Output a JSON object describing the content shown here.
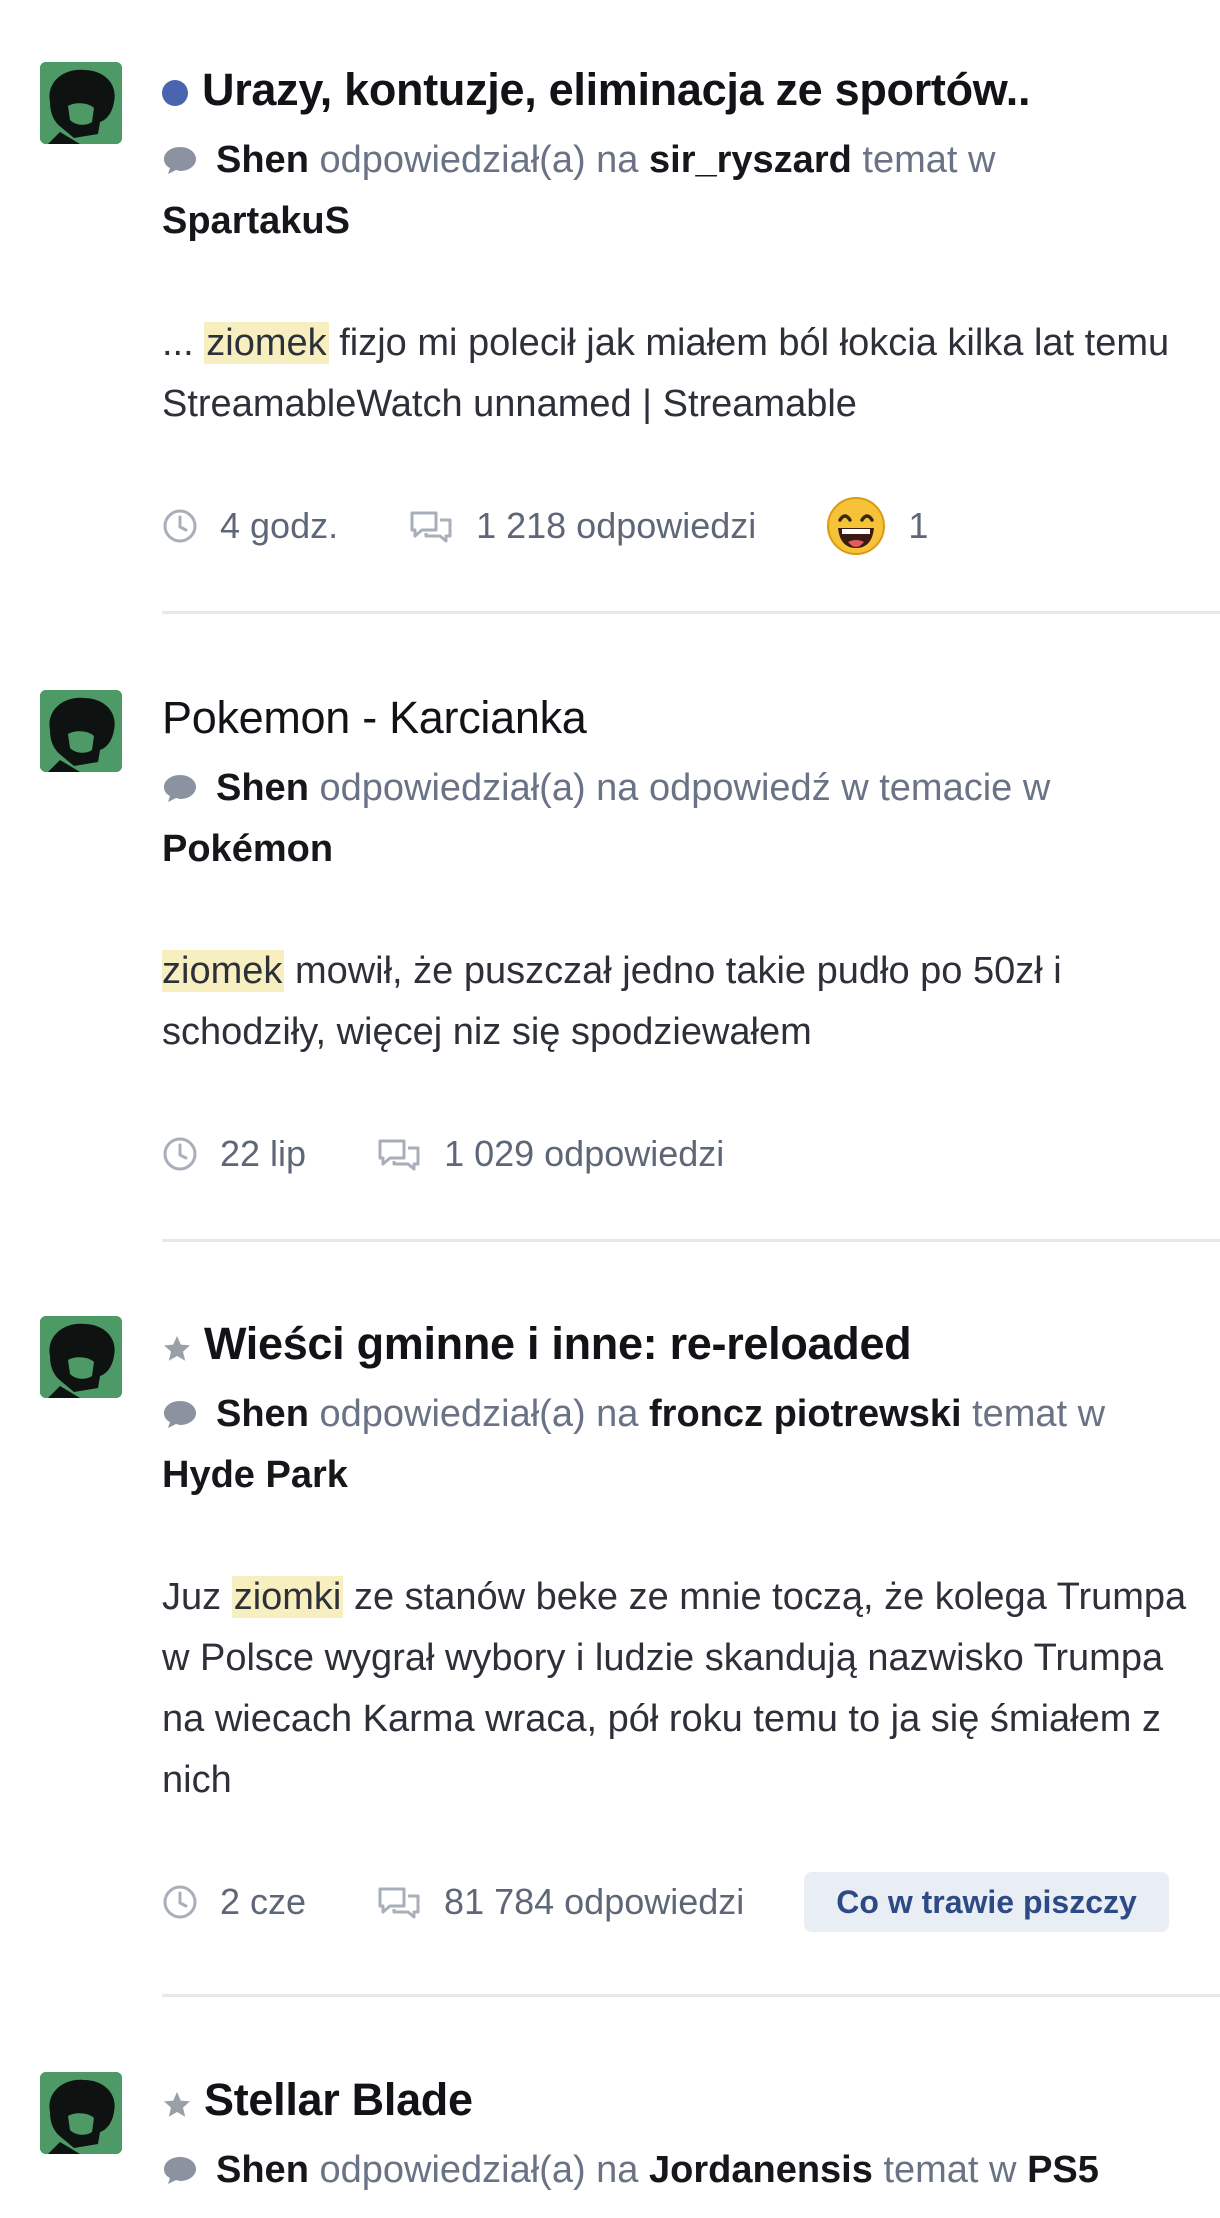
{
  "feed": {
    "items": [
      {
        "title": "Urazy, kontuzje, eliminacja ze sportów..",
        "user": "Shen",
        "action": "odpowiedział(a) na",
        "target": "sir_ryszard",
        "suffix": "temat w",
        "forum": "SpartakuS",
        "snippet_before": "...",
        "highlight": "ziomek",
        "snippet_after": "fizjo mi polecił jak miałem ból łokcia kilka lat temu StreamableWatch unnamed | Streamable",
        "time": "4 godz.",
        "replies": "1 218 odpowiedzi",
        "reaction_count": "1"
      },
      {
        "title": "Pokemon - Karcianka",
        "user": "Shen",
        "action": "odpowiedział(a) na odpowiedź w temacie w",
        "forum": "Pokémon",
        "highlight": "ziomek",
        "snippet_after": "mowił, że puszczał jedno takie pudło po 50zł i schodziły, więcej niz się spodziewałem",
        "time": "22 lip",
        "replies": "1 029 odpowiedzi"
      },
      {
        "title": "Wieści gminne i inne: re-reloaded",
        "user": "Shen",
        "action": "odpowiedział(a) na",
        "target": "froncz piotrewski",
        "suffix": "temat w",
        "forum": "Hyde Park",
        "snippet_before": "Juz",
        "highlight": "ziomki",
        "snippet_after": "ze stanów beke ze mnie toczą, że kolega Trumpa w Polsce wygrał wybory i ludzie skandują nazwisko Trumpa na wiecach Karma wraca, pół roku temu to ja się śmiałem z nich",
        "time": "2 cze",
        "replies": "81 784 odpowiedzi",
        "tag": "Co w trawie piszczy"
      },
      {
        "title": "Stellar Blade",
        "user": "Shen",
        "action": "odpowiedział(a) na",
        "target": "Jordanensis",
        "suffix": "temat w",
        "forum": "PS5"
      }
    ]
  },
  "colors": {
    "unread_dot": "#4a64b0",
    "highlight": "#f8efc1",
    "avatar_bg": "#4e9a66",
    "tag_bg": "#e9edf4",
    "tag_text": "#2c4a86"
  },
  "icons": [
    "unread-dot",
    "star-icon",
    "chat-bubble-icon",
    "clock-icon",
    "replies-icon",
    "laughing-emoji-icon"
  ]
}
